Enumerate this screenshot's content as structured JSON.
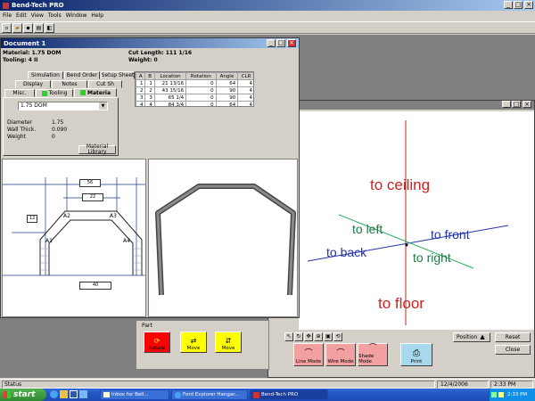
{
  "app": {
    "title": "Bend-Tech PRO",
    "menu": [
      "File",
      "Edit",
      "View",
      "Tools",
      "Window",
      "Help"
    ]
  },
  "document": {
    "title": "Document 1",
    "material_line": "Material: 1.75 DOM",
    "tooling_line": "Tooling: 4 II",
    "cut_length": "Cut Length: 111  1/16",
    "weight_line": "Weight: 0",
    "tabs_row1": [
      "Simulation",
      "Bend Order",
      "Setup Sheet"
    ],
    "tabs_row2": [
      "Display",
      "Notes",
      "Cut Sh"
    ],
    "tabs_row3": [
      "Misc.",
      "Tooling",
      "Materia"
    ],
    "material_select": "1.75 DOM",
    "props": [
      {
        "label": "Diameter",
        "value": "1.75"
      },
      {
        "label": "Wall Thick.",
        "value": "0.090"
      },
      {
        "label": "Weight",
        "value": "0"
      }
    ],
    "material_library_btn": "Material Library",
    "bend_table": {
      "headers": [
        "A",
        "B",
        "Location",
        "Rotation",
        "Angle",
        "CLR"
      ],
      "rows": [
        [
          "1",
          "1",
          "21  13/16",
          "0",
          "64",
          "4"
        ],
        [
          "2",
          "2",
          "43  15/16",
          "0",
          "90",
          "4"
        ],
        [
          "3",
          "3",
          "65  1/4",
          "0",
          "90",
          "4"
        ],
        [
          "4",
          "4",
          "84  3/4",
          "0",
          "64",
          "4"
        ]
      ]
    },
    "drawing_labels": {
      "top": "56",
      "top2": "22",
      "side": "12",
      "bottom": "40",
      "a1": "A1",
      "a2": "A2",
      "a3": "A3",
      "a4": "A4"
    }
  },
  "viewport": {
    "to_ceiling": "to ceiling",
    "to_floor": "to floor",
    "to_left": "to left",
    "to_right": "to right",
    "to_back": "to back",
    "to_front": "to front",
    "position_btn": "Position",
    "reset_btn": "Reset",
    "close_btn": "Close"
  },
  "part_panel": {
    "label": "Part",
    "buttons": [
      "Rotate",
      "Move",
      "Move"
    ]
  },
  "mode_buttons": [
    "Line Mode",
    "Wire Mode",
    "Shade Mode",
    "Print"
  ],
  "status": {
    "text": "Status",
    "date": "12/4/2006",
    "time": "2:33 PM"
  },
  "taskbar": {
    "start": "start",
    "tasks": [
      "Inbox for Bell...",
      "Ford Explorer Hangar...",
      "Bend-Tech PRO"
    ],
    "clock": "2:33 PM"
  },
  "colors": {
    "title_active": "#0a246a",
    "ceiling": "#cc2222",
    "vertical_axis": "#cc2222",
    "horizontal_axis": "#2233aa",
    "depth_axis": "#22aa55",
    "lr_text": "#227744",
    "fb_text": "#2233aa",
    "part_button": "#ffff00",
    "mode_button": "#f2a0a0"
  }
}
